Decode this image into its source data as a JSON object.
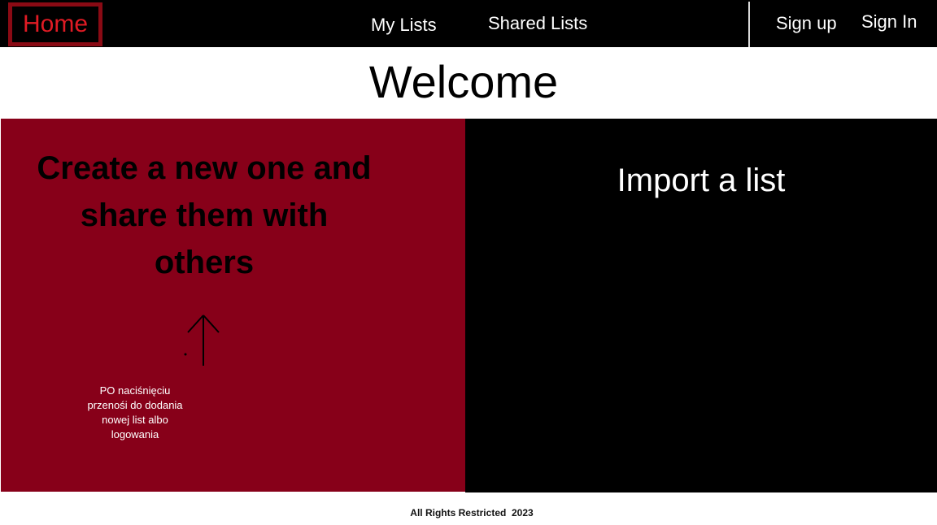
{
  "nav": {
    "home_label": "Home",
    "my_lists_label": "My Lists",
    "shared_lists_label": "Shared Lists",
    "sign_up_label": "Sign up",
    "sign_in_label": "Sign In"
  },
  "main": {
    "welcome_title": "Welcome",
    "create_panel": {
      "title": "Create a new one and share them with others",
      "note": "PO naciśnięciu przenośi do dodania nowej list albo logowania",
      "icon": "arrow-up-icon"
    },
    "import_panel": {
      "title": "Import a list"
    }
  },
  "footer": {
    "text": "All Rights Restricted  2023"
  },
  "colors": {
    "nav_background": "#000000",
    "home_text": "#e01b24",
    "home_border": "#8a0a14",
    "create_panel": "#870019",
    "import_panel": "#000000"
  }
}
